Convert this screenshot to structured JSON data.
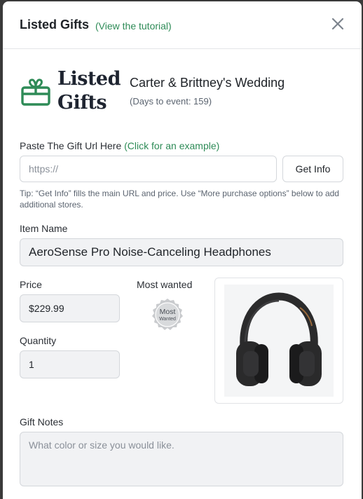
{
  "header": {
    "title": "Listed Gifts",
    "tutorial_link": "(View the tutorial)"
  },
  "brand": {
    "logo_line1": "Listed",
    "logo_line2": "Gifts",
    "accent_color": "#2e8b57"
  },
  "event": {
    "name": "Carter & Brittney's Wedding",
    "days": "(Days to event: 159)"
  },
  "url_section": {
    "label": "Paste The Gift Url Here",
    "example_link": "(Click for an example)",
    "placeholder": "https://",
    "get_info_label": "Get Info",
    "tip": "Tip: “Get Info” fills the main URL and price. Use “More purchase options” below to add additional stores."
  },
  "item": {
    "name_label": "Item Name",
    "name_value": "AeroSense Pro Noise-Canceling Headphones",
    "price_label": "Price",
    "price_value": "$229.99",
    "most_wanted_label": "Most wanted",
    "badge_line1": "Most",
    "badge_line2": "Wanted",
    "quantity_label": "Quantity",
    "quantity_value": "1",
    "image_icon": "headphones-image"
  },
  "notes": {
    "label": "Gift Notes",
    "placeholder": "What color or size you would like."
  }
}
